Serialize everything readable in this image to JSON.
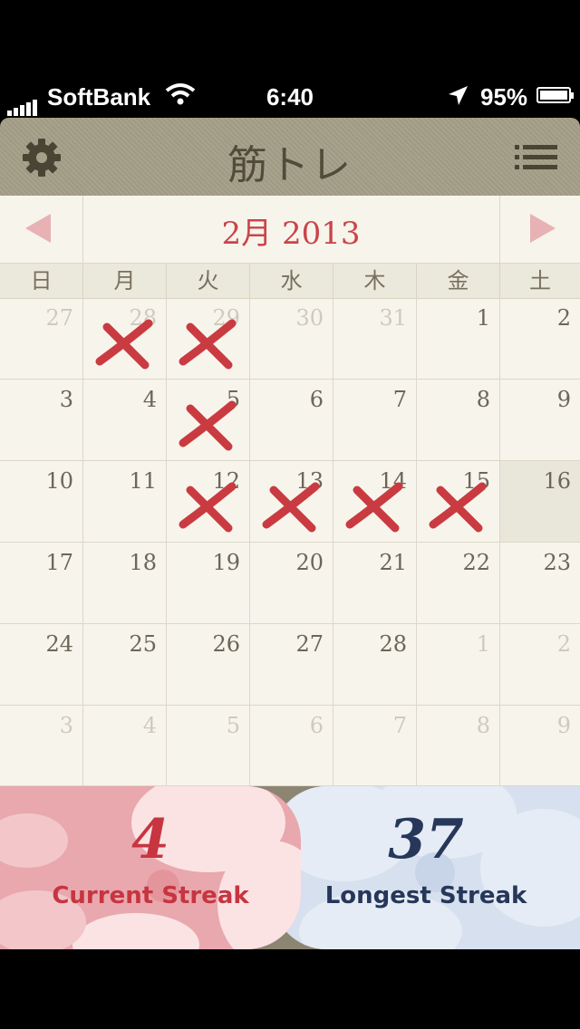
{
  "status_bar": {
    "carrier": "SoftBank",
    "time": "6:40",
    "battery": "95%",
    "battery_level": 0.95
  },
  "nav": {
    "title": "筋トレ",
    "settings_icon": "gear-icon",
    "menu_icon": "list-menu-icon"
  },
  "calendar": {
    "month_label": "2月 2013",
    "prev_icon": "triangle-left-icon",
    "next_icon": "triangle-right-icon",
    "weekdays": [
      "日",
      "月",
      "火",
      "水",
      "木",
      "金",
      "土"
    ],
    "weeks": [
      [
        {
          "day": "27",
          "current": false,
          "marked": false
        },
        {
          "day": "28",
          "current": false,
          "marked": true
        },
        {
          "day": "29",
          "current": false,
          "marked": true
        },
        {
          "day": "30",
          "current": false,
          "marked": false
        },
        {
          "day": "31",
          "current": false,
          "marked": false
        },
        {
          "day": "1",
          "current": true,
          "marked": false
        },
        {
          "day": "2",
          "current": true,
          "marked": false
        }
      ],
      [
        {
          "day": "3",
          "current": true,
          "marked": false
        },
        {
          "day": "4",
          "current": true,
          "marked": false
        },
        {
          "day": "5",
          "current": true,
          "marked": true
        },
        {
          "day": "6",
          "current": true,
          "marked": false
        },
        {
          "day": "7",
          "current": true,
          "marked": false
        },
        {
          "day": "8",
          "current": true,
          "marked": false
        },
        {
          "day": "9",
          "current": true,
          "marked": false
        }
      ],
      [
        {
          "day": "10",
          "current": true,
          "marked": false
        },
        {
          "day": "11",
          "current": true,
          "marked": false
        },
        {
          "day": "12",
          "current": true,
          "marked": true
        },
        {
          "day": "13",
          "current": true,
          "marked": true
        },
        {
          "day": "14",
          "current": true,
          "marked": true
        },
        {
          "day": "15",
          "current": true,
          "marked": true
        },
        {
          "day": "16",
          "current": true,
          "marked": false,
          "today": true
        }
      ],
      [
        {
          "day": "17",
          "current": true,
          "marked": false
        },
        {
          "day": "18",
          "current": true,
          "marked": false
        },
        {
          "day": "19",
          "current": true,
          "marked": false
        },
        {
          "day": "20",
          "current": true,
          "marked": false
        },
        {
          "day": "21",
          "current": true,
          "marked": false
        },
        {
          "day": "22",
          "current": true,
          "marked": false
        },
        {
          "day": "23",
          "current": true,
          "marked": false
        }
      ],
      [
        {
          "day": "24",
          "current": true,
          "marked": false
        },
        {
          "day": "25",
          "current": true,
          "marked": false
        },
        {
          "day": "26",
          "current": true,
          "marked": false
        },
        {
          "day": "27",
          "current": true,
          "marked": false
        },
        {
          "day": "28",
          "current": true,
          "marked": false
        },
        {
          "day": "1",
          "current": false,
          "marked": false
        },
        {
          "day": "2",
          "current": false,
          "marked": false
        }
      ],
      [
        {
          "day": "3",
          "current": false,
          "marked": false
        },
        {
          "day": "4",
          "current": false,
          "marked": false
        },
        {
          "day": "5",
          "current": false,
          "marked": false
        },
        {
          "day": "6",
          "current": false,
          "marked": false
        },
        {
          "day": "7",
          "current": false,
          "marked": false
        },
        {
          "day": "8",
          "current": false,
          "marked": false
        },
        {
          "day": "9",
          "current": false,
          "marked": false
        }
      ]
    ],
    "mark_icon": "red-x-mark-icon",
    "mark_color": "#c93b41"
  },
  "streaks": {
    "current": {
      "value": "4",
      "label": "Current Streak"
    },
    "longest": {
      "value": "37",
      "label": "Longest Streak"
    }
  },
  "colors": {
    "accent_red": "#c9454a",
    "nav_bg": "#a59f88",
    "paper": "#f7f4ec",
    "longest_navy": "#26375a"
  }
}
